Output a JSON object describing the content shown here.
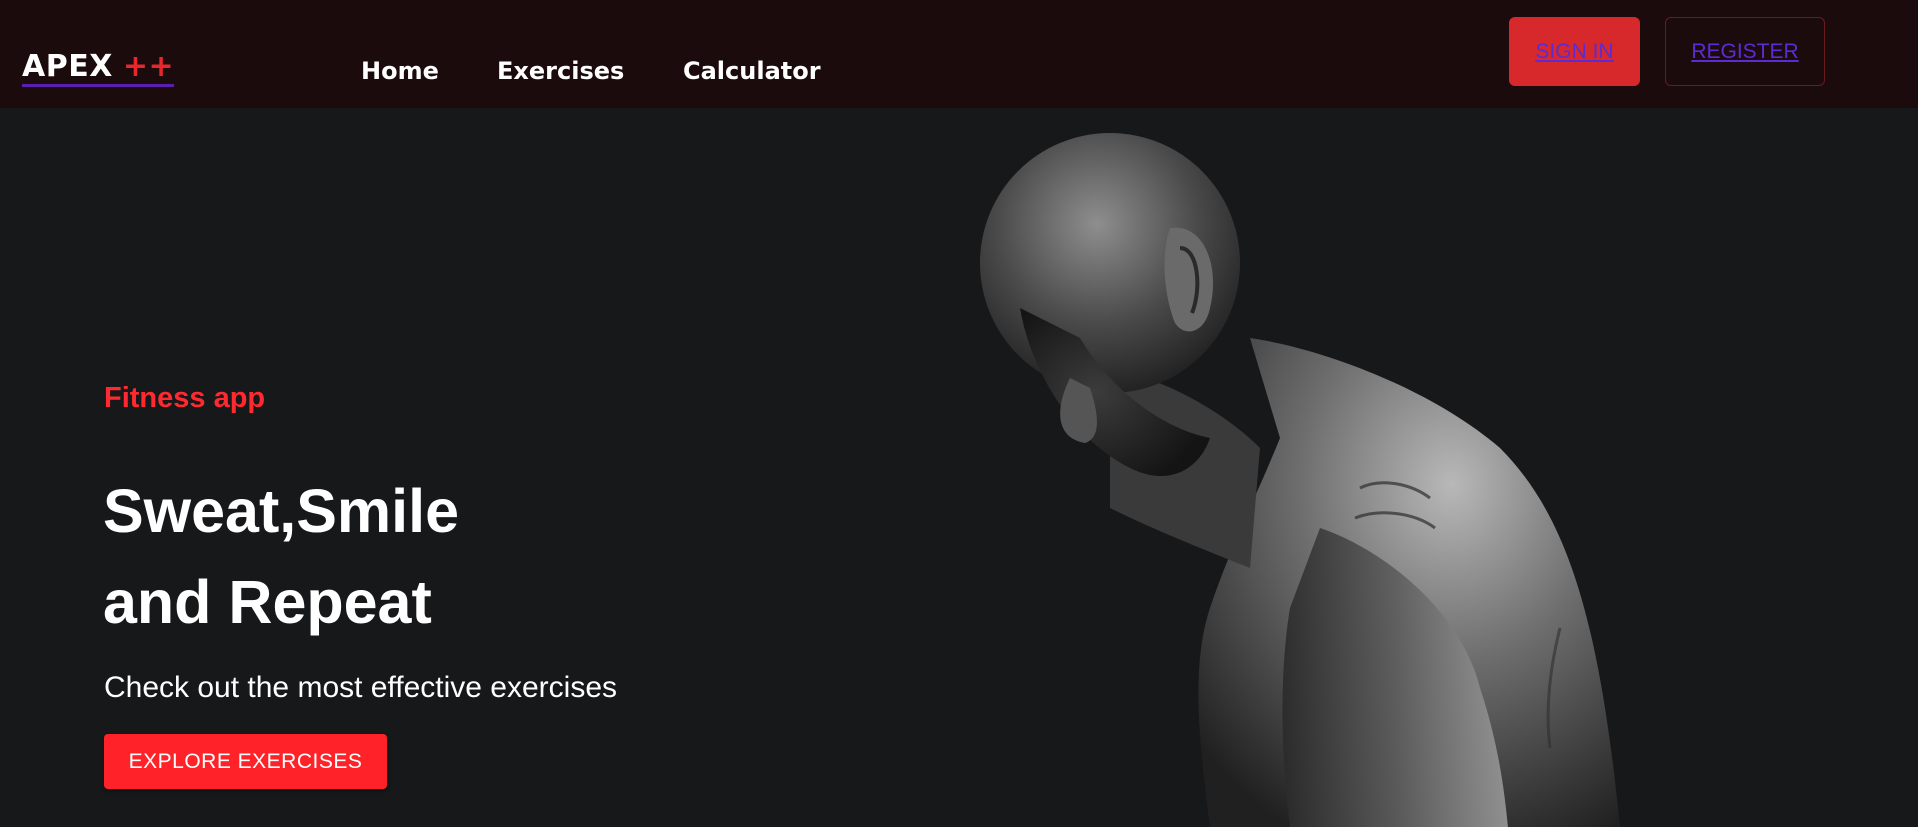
{
  "brand": {
    "name": "APEX",
    "suffix": "++"
  },
  "nav": {
    "home": "Home",
    "exercises": "Exercises",
    "calculator": "Calculator"
  },
  "auth": {
    "sign_in": "SIGN IN",
    "register": "REGISTER"
  },
  "hero": {
    "eyebrow": "Fitness app",
    "title_line1": "Sweat,Smile",
    "title_line2": "and Repeat",
    "subtitle": "Check out the most effective exercises",
    "cta": "EXPLORE EXERCISES",
    "image": "athlete-photo"
  },
  "colors": {
    "navbar_bg": "#1c0b0c",
    "page_bg": "#17181a",
    "accent": "#ff2228",
    "link": "#5b2bd6"
  }
}
